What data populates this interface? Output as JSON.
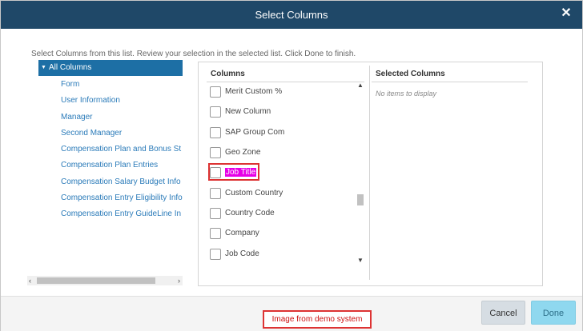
{
  "dialog": {
    "title": "Select Columns",
    "close_glyph": "✕",
    "instructions": "Select Columns from this list. Review your selection in the selected list. Click Done to finish."
  },
  "tree": {
    "root_label": "All Columns",
    "items": [
      "Form",
      "User Information",
      "Manager",
      "Second Manager",
      "Compensation Plan and Bonus St",
      "Compensation Plan Entries",
      "Compensation Salary Budget Info",
      "Compensation Entry Eligibility Info",
      "Compensation Entry GuideLine In"
    ]
  },
  "columns": {
    "header": "Columns",
    "items": [
      "Merit Custom %",
      "New Column",
      "SAP Group Com",
      "Geo Zone",
      "Job Title",
      "Custom Country",
      "Country Code",
      "Company",
      "Job Code"
    ],
    "highlighted": "Job Title"
  },
  "selected": {
    "header": "Selected Columns",
    "empty_text": "No items to display"
  },
  "footer": {
    "cancel_label": "Cancel",
    "done_label": "Done"
  },
  "watermark": "Image from demo system",
  "colors": {
    "titlebar": "#1f4868",
    "tree_selected": "#1d6fa5",
    "link": "#2b7bb9",
    "highlight": "#e600e6",
    "done_button": "#8fd8ef",
    "annotation_red": "#dd3333"
  }
}
